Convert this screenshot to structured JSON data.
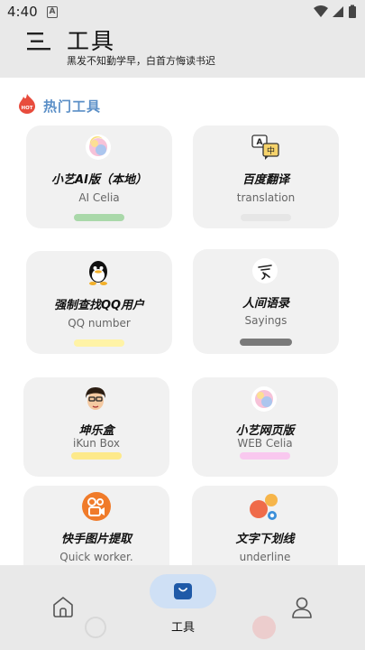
{
  "status": {
    "time": "4:40",
    "indicator": "A"
  },
  "header": {
    "title": "工具",
    "subtitle": "黑发不知勤学早，白首方悔读书迟",
    "menu_icon": "menu-icon"
  },
  "section": {
    "title": "热门工具",
    "badge": "HOT"
  },
  "tools": [
    {
      "name": "小艺AI版（本地）",
      "subtitle": "AI Celia",
      "bar_color": "#a9d8a9",
      "icon": "celia-icon"
    },
    {
      "name": "百度翻译",
      "subtitle": "translation",
      "bar_color": "#e6e6e6",
      "icon": "translate-icon"
    },
    {
      "name": "强制查找QQ用户",
      "subtitle": "QQ number",
      "bar_color": "#fff3a6",
      "icon": "qq-penguin-icon"
    },
    {
      "name": "人间语录",
      "subtitle": "Sayings",
      "bar_color": "#7a7a7a",
      "icon": "sayings-icon"
    },
    {
      "name": "坤乐盒",
      "subtitle": "iKun Box",
      "bar_color": "#fde98a",
      "icon": "ikun-avatar-icon"
    },
    {
      "name": "小艺网页版",
      "subtitle": "WEB Celia",
      "bar_color": "#f9c8ef",
      "icon": "celia-icon"
    },
    {
      "name": "快手图片提取",
      "subtitle": "Quick worker.",
      "bar_color": "#f0e2c8",
      "icon": "kuaishou-icon"
    },
    {
      "name": "文字下划线",
      "subtitle": "underline",
      "bar_color": "#e6e6e6",
      "icon": "underline-dots-icon"
    }
  ],
  "nav": {
    "tools_label": "工具",
    "items": [
      "home-icon",
      "tools-bag-icon",
      "user-icon"
    ]
  }
}
